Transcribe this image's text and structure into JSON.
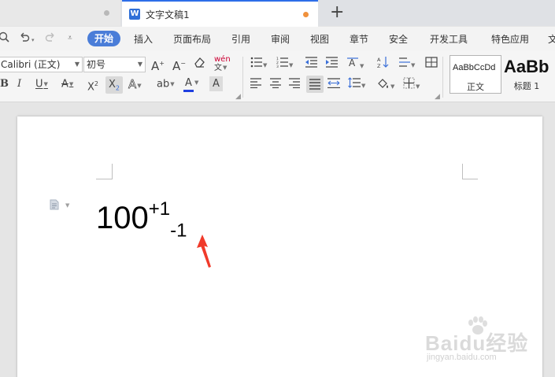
{
  "tabs": {
    "document_title": "文字文稿1",
    "app_icon_letter": "W",
    "new_tab_symbol": "+"
  },
  "menu": {
    "items": [
      "开始",
      "插入",
      "页面布局",
      "引用",
      "审阅",
      "视图",
      "章节",
      "安全",
      "开发工具",
      "特色应用",
      "文"
    ],
    "active": "开始"
  },
  "ribbon": {
    "font_name": "Calibri (正文)",
    "font_size": "初号",
    "styles": [
      {
        "preview": "AaBbCcDd",
        "label": "正文"
      },
      {
        "preview": "AaBb",
        "label": "标题 1"
      }
    ]
  },
  "document": {
    "base": "100",
    "superscript": "+1",
    "subscript": "-1"
  },
  "watermark": {
    "logo": "Baidu经验",
    "url": "jingyan.baidu.com"
  },
  "colors": {
    "accent": "#4a7dd8",
    "arrow": "#f03a2a",
    "font_color_bar": "#1f3fe0",
    "modified_dot": "#f0913c"
  }
}
